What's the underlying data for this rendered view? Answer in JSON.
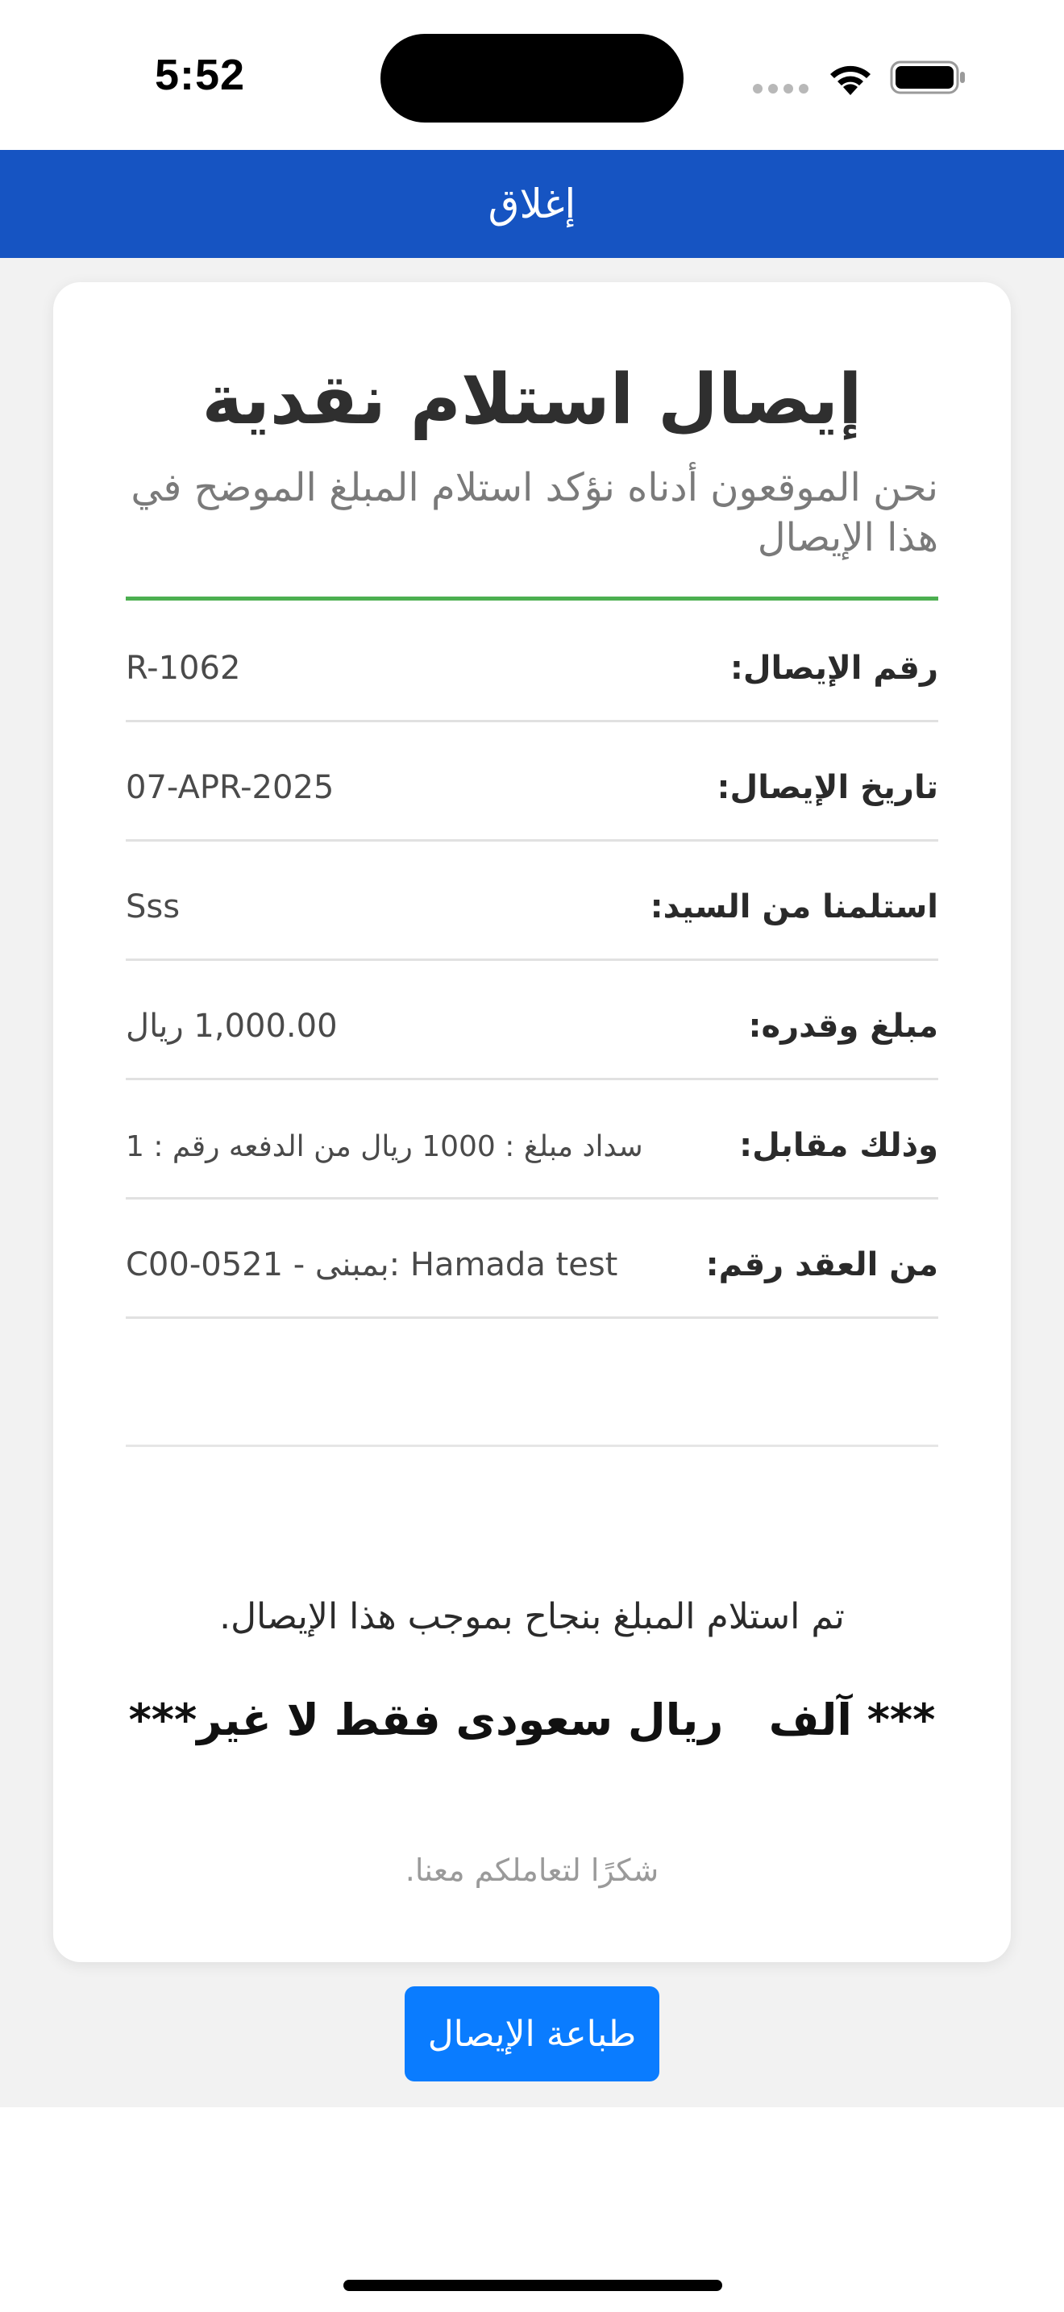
{
  "status_bar": {
    "time": "5:52",
    "icons": [
      "signal-icon",
      "wifi-icon",
      "battery-icon"
    ]
  },
  "header": {
    "close_label": "إغلاق",
    "background_color": "#1654c2"
  },
  "receipt": {
    "title": "إيصال استلام نقدية",
    "subtitle": "نحن الموقعون أدناه نؤكد استلام المبلغ الموضح في هذا الإيصال",
    "accent_line_color": "#4caf50",
    "rows": [
      {
        "label": "رقم الإيصال:",
        "value": "R-1062"
      },
      {
        "label": "تاريخ الإيصال:",
        "value": "07-APR-2025"
      },
      {
        "label": "استلمنا من السيد:",
        "value": "Sss"
      },
      {
        "label": "مبلغ وقدره:",
        "value": "1,000.00 ريال"
      },
      {
        "label": "وذلك مقابل:",
        "value": "سداد مبلغ  :  1000 ريال من الدفعه رقم : 1"
      },
      {
        "label": "من العقد رقم:",
        "value": "C00-0521 - بمبنى: Hamada test"
      }
    ],
    "success_message": "تم استلام المبلغ بنجاح بموجب هذا الإيصال.",
    "amount_in_words": "*** آلف   ريال سعودى فقط لا غير***",
    "thanks": "شكرًا لتعاملكم معنا."
  },
  "actions": {
    "print_label": "طباعة الإيصال",
    "print_color": "#0a7cff"
  }
}
